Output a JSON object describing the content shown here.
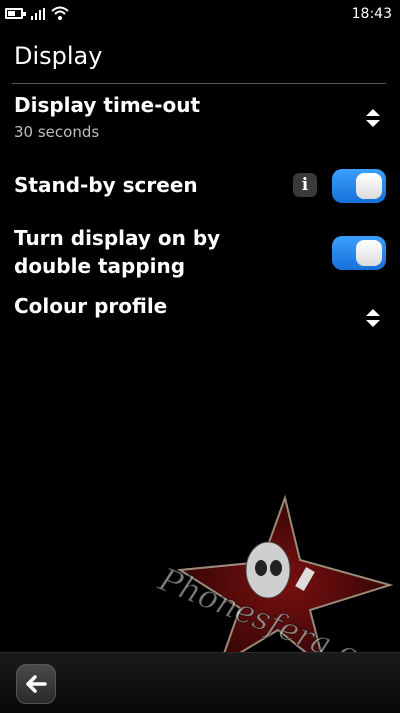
{
  "status_bar": {
    "time": "18:43",
    "icons": [
      "battery-icon",
      "signal-strength-icon",
      "wifi-icon"
    ]
  },
  "page": {
    "title": "Display"
  },
  "settings": [
    {
      "label": "Display time-out",
      "value": "30 seconds",
      "control": "selector",
      "icon": "selector-arrows-icon"
    },
    {
      "label": "Stand-by screen",
      "control": "toggle",
      "state": "on",
      "extra_icon": "info-icon"
    },
    {
      "label": "Turn display on by double tapping",
      "control": "toggle",
      "state": "on"
    },
    {
      "label": "Colour profile",
      "control": "selector",
      "icon": "selector-arrows-icon"
    }
  ],
  "info_glyph": "i",
  "watermark": {
    "text": "Phonesfera.com"
  },
  "toolbar": {
    "back_icon": "back-arrow-icon"
  },
  "colors": {
    "background": "#000000",
    "toggle_on": "#2d8cf0",
    "subtext": "#bfbfbf"
  }
}
